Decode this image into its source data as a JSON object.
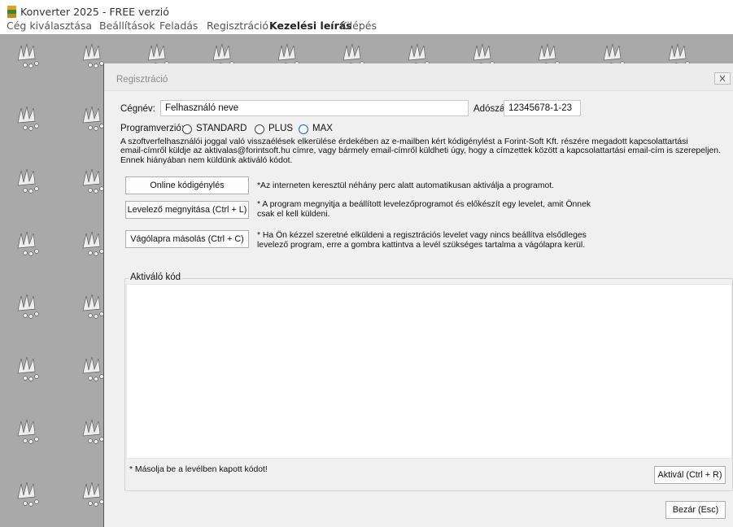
{
  "window": {
    "title": "Konverter 2025 - FREE verzió"
  },
  "menu": {
    "items": [
      {
        "label": "Cég kiválasztása",
        "bold": false
      },
      {
        "label": "Beállítások",
        "bold": false
      },
      {
        "label": "Feladás",
        "bold": false
      },
      {
        "label": "Regisztráció",
        "bold": false
      },
      {
        "label": "Kezelési leírás",
        "bold": true
      },
      {
        "label": "Kilépés",
        "bold": false
      }
    ]
  },
  "dialog": {
    "title": "Regisztráció",
    "company_label": "Cégnév:",
    "company_value": "Felhasználó neve",
    "tax_label": "Adószám:",
    "tax_value": "12345678-1-23",
    "version_label": "Programverzió:",
    "versions": [
      {
        "label": "STANDARD",
        "selected": false
      },
      {
        "label": "PLUS",
        "selected": false
      },
      {
        "label": "MAX",
        "selected": true
      }
    ],
    "info_lines": [
      "A szoftverfelhasználói joggal való visszaélések elkerülése érdekében az e-mailben kért kódigénylést a Forint-Soft Kft. részére megadott kapcsolattartási",
      "email-címről küldje  az aktivalas@forintsoft.hu címre, vagy bármely email-címről küldheti úgy, hogy a címzettek között a kapcsolattartási email-cím is szerepeljen.",
      "Ennek hiányában nem küldünk aktiváló kódot."
    ],
    "actions": [
      {
        "button": "Online kódigénylés",
        "desc_lines": [
          "*Az interneten keresztül néhány perc alatt automatikusan aktiválja a programot."
        ]
      },
      {
        "button": "Levelező megnyitása (Ctrl + L)",
        "desc_lines": [
          "* A program megnyitja a beállított levelezőprogramot és előkészít egy levelet, amit Önnek",
          "csak el kell küldeni."
        ]
      },
      {
        "button": "Vágólapra másolás (Ctrl + C)",
        "desc_lines": [
          "* Ha Ön kézzel szeretné elküldeni a regisztrációs levelet vagy nincs beállítva elsődleges",
          "levelező program, erre a gombra kattintva a levél szükséges tartalma a vágólapra kerül."
        ]
      }
    ],
    "activation_group_title": "Aktiváló kód",
    "activation_code": "",
    "paste_note": "* Másolja be a levélben kapott kódot!",
    "activate_button": "Aktivál (Ctrl + R)",
    "close_button": "Bezár (Esc)"
  },
  "colors": {
    "background_pattern": "#a9a9a9",
    "dialog_background": "#f0f0f0",
    "radio_selected": "#1f66d4"
  }
}
